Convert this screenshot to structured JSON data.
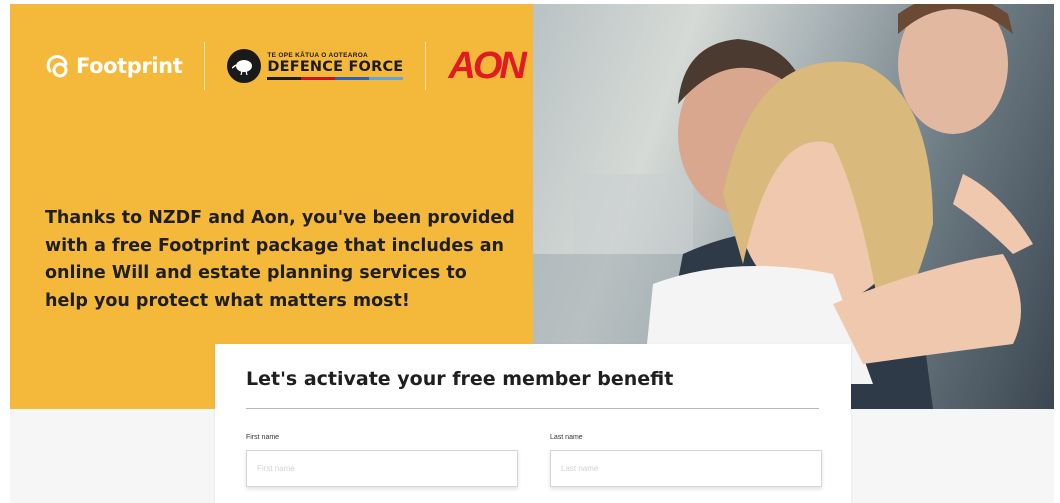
{
  "logos": {
    "footprint": "Footprint",
    "nzdf_top": "TE OPE KĀTUA O AOTEAROA",
    "nzdf_main": "DEFENCE FORCE",
    "aon": "AON"
  },
  "hero": {
    "tagline": "Thanks to NZDF and Aon, you've been provided with a free Footprint package that includes an online Will and estate planning services to help you protect what matters most!",
    "accent_color": "#f4b93b"
  },
  "form": {
    "title": "Let's activate your free member benefit",
    "first_name": {
      "label": "First name",
      "placeholder": "First name",
      "value": ""
    },
    "last_name": {
      "label": "Last name",
      "placeholder": "Last name",
      "value": ""
    }
  },
  "colors": {
    "aon_red": "#e11b22",
    "text_dark": "#1f1f1f"
  }
}
